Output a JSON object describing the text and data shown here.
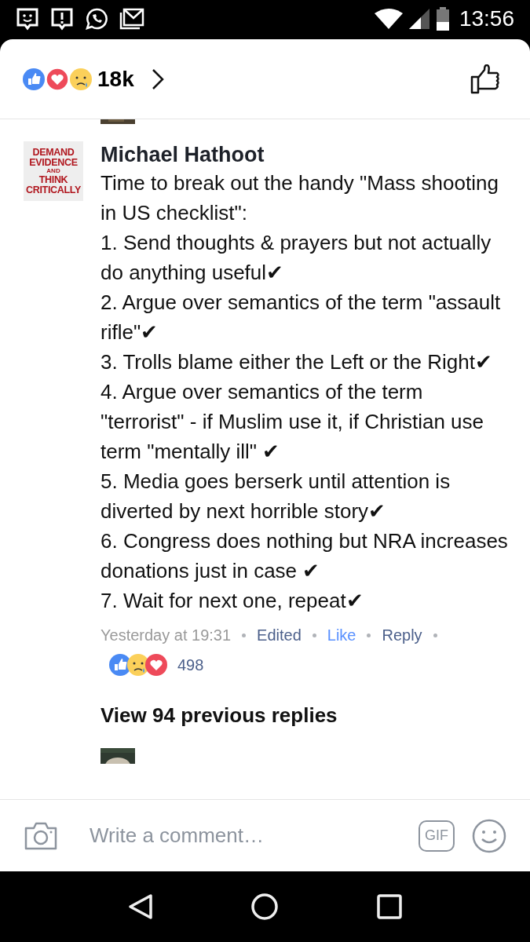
{
  "status_bar": {
    "time": "13:56"
  },
  "header": {
    "reaction_count": "18k"
  },
  "comment": {
    "author": "Michael Hathoot",
    "avatar_lines": [
      "DEMAND",
      "EVIDENCE",
      "AND",
      "THINK",
      "CRITICALLY"
    ],
    "paragraphs": [
      "Time to break out the handy \"Mass shooting in US checklist\":",
      "1.  Send thoughts & prayers but not actually do anything useful✔",
      "2.  Argue over semantics of the term \"assault rifle\"✔",
      "3.  Trolls blame either the Left or the Right✔",
      "4.  Argue over semantics of the term \"terrorist\" - if Muslim use it, if Christian use term \"mentally ill\" ✔",
      "5.  Media goes berserk until attention is diverted by next horrible story✔",
      "6.  Congress does nothing but NRA increases donations just in case ✔",
      "7.  Wait for next one, repeat✔"
    ],
    "time": "Yesterday at 19:31",
    "actions": [
      {
        "label": "Edited",
        "kind": "meta"
      },
      {
        "label": "Like",
        "kind": "link"
      },
      {
        "label": "Reply",
        "kind": "action"
      }
    ],
    "reaction_count": "498"
  },
  "view_replies": "View 94 previous replies",
  "composer": {
    "placeholder": "Write a comment…",
    "gif_label": "GIF"
  }
}
